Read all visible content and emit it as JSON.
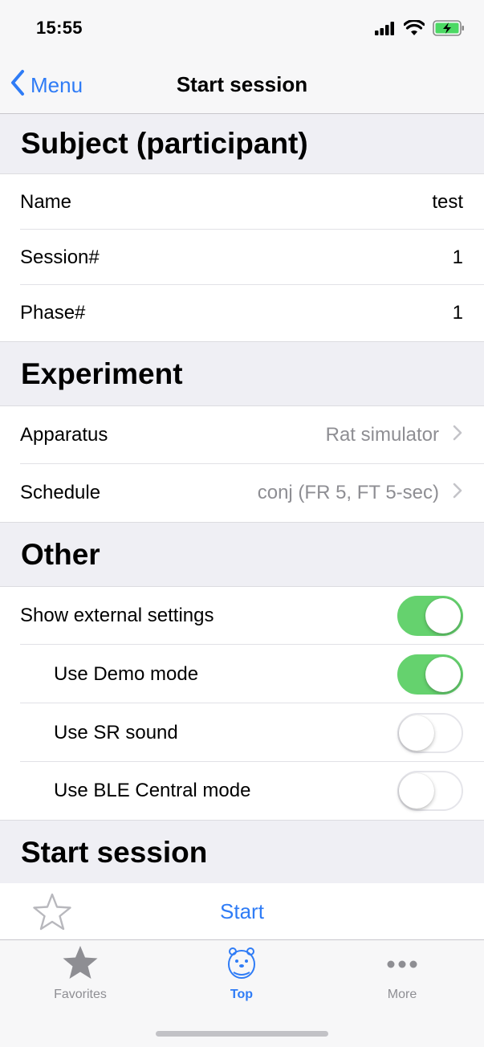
{
  "status_bar": {
    "time": "15:55",
    "icons": [
      "cellular-signal-icon",
      "wifi-icon",
      "battery-charging-icon"
    ]
  },
  "nav": {
    "back_label": "Menu",
    "title": "Start session"
  },
  "sections": {
    "subject": {
      "header": "Subject (participant)",
      "rows": [
        {
          "label": "Name",
          "value": "test"
        },
        {
          "label": "Session#",
          "value": "1"
        },
        {
          "label": "Phase#",
          "value": "1"
        }
      ]
    },
    "experiment": {
      "header": "Experiment",
      "rows": [
        {
          "label": "Apparatus",
          "value": "Rat simulator"
        },
        {
          "label": "Schedule",
          "value": "conj (FR 5, FT 5-sec)"
        }
      ]
    },
    "other": {
      "header": "Other",
      "rows": [
        {
          "label": "Show external settings",
          "on": true
        },
        {
          "label": "Use Demo mode",
          "on": true
        },
        {
          "label": "Use SR sound",
          "on": false
        },
        {
          "label": "Use BLE Central mode",
          "on": false
        }
      ]
    },
    "start": {
      "header": "Start session",
      "button_label": "Start"
    }
  },
  "tab_bar": {
    "tabs": [
      {
        "label": "Favorites",
        "icon": "star-icon",
        "active": false
      },
      {
        "label": "Top",
        "icon": "hamster-icon",
        "active": true
      },
      {
        "label": "More",
        "icon": "more-dots-icon",
        "active": false
      }
    ]
  },
  "colors": {
    "accent": "#2f7cf6",
    "switch_on": "#65d26e",
    "section_bg": "#efeff4",
    "secondary_text": "#8e8e93"
  }
}
